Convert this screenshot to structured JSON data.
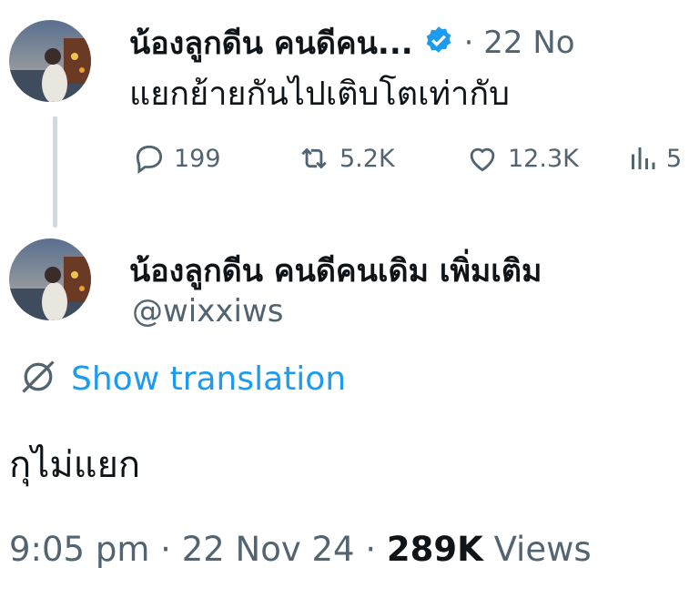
{
  "parent_tweet": {
    "display_name": "น้องลูกดีน คนดีคน...",
    "separator": "·",
    "date": "22 No",
    "text": "แยกย้ายกันไปเติบโตเท่ากับ",
    "stats": {
      "replies": "199",
      "reposts": "5.2K",
      "likes": "12.3K",
      "views": "5"
    }
  },
  "main_tweet": {
    "display_name": "น้องลูกดีน คนดีคนเดิม เพิ่มเติม",
    "handle": "@wixxiws",
    "translate_label": "Show translation",
    "text": "กุไม่แยก",
    "timestamp": {
      "time": "9:05 pm",
      "sep1": "·",
      "date": "22 Nov 24",
      "sep2": "·",
      "views_count": "289K",
      "views_label": "Views"
    }
  },
  "colors": {
    "accent": "#1d9bf0",
    "muted": "#536471",
    "text": "#0f1419",
    "thread_line": "#cfd9de"
  },
  "icons": [
    "verified-badge-icon",
    "reply-icon",
    "repost-icon",
    "like-icon",
    "views-icon",
    "globe-translate-icon"
  ]
}
